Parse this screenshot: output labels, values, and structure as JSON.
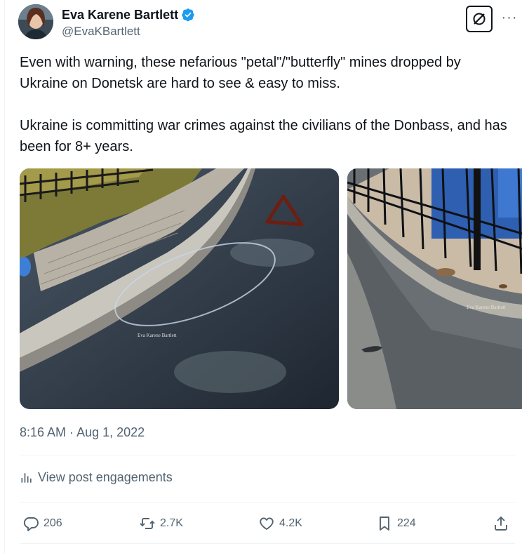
{
  "author": {
    "display_name": "Eva Karene Bartlett",
    "handle": "@EvaKBartlett",
    "verified": true,
    "verified_color": "#1d9bf0"
  },
  "tweet": {
    "paragraph_1": "Even with warning, these nefarious \"petal\"/\"butterfly\" mines dropped by Ukraine on Donetsk are hard to see & easy to miss.",
    "paragraph_2": "Ukraine is committing war crimes against the civilians of the Donbass, and has been for 8+ years."
  },
  "media": {
    "photo_1_watermark": "Eva Karene Bartlett",
    "photo_2_watermark": "Eva Karene Bartlett"
  },
  "meta": {
    "time": "8:16 AM",
    "separator": " · ",
    "date": "Aug 1, 2022"
  },
  "engagements_label": "View post engagements",
  "actions": {
    "replies": "206",
    "reposts": "2.7K",
    "likes": "4.2K",
    "bookmarks": "224"
  },
  "icons": {
    "grok": "grok-icon",
    "more": "more-icon",
    "reply": "reply-icon",
    "repost": "repost-icon",
    "like": "heart-icon",
    "bookmark": "bookmark-icon",
    "share": "share-icon",
    "analytics": "analytics-icon"
  },
  "colors": {
    "text_primary": "#0f1419",
    "text_secondary": "#536471",
    "divider": "#eff3f4"
  }
}
